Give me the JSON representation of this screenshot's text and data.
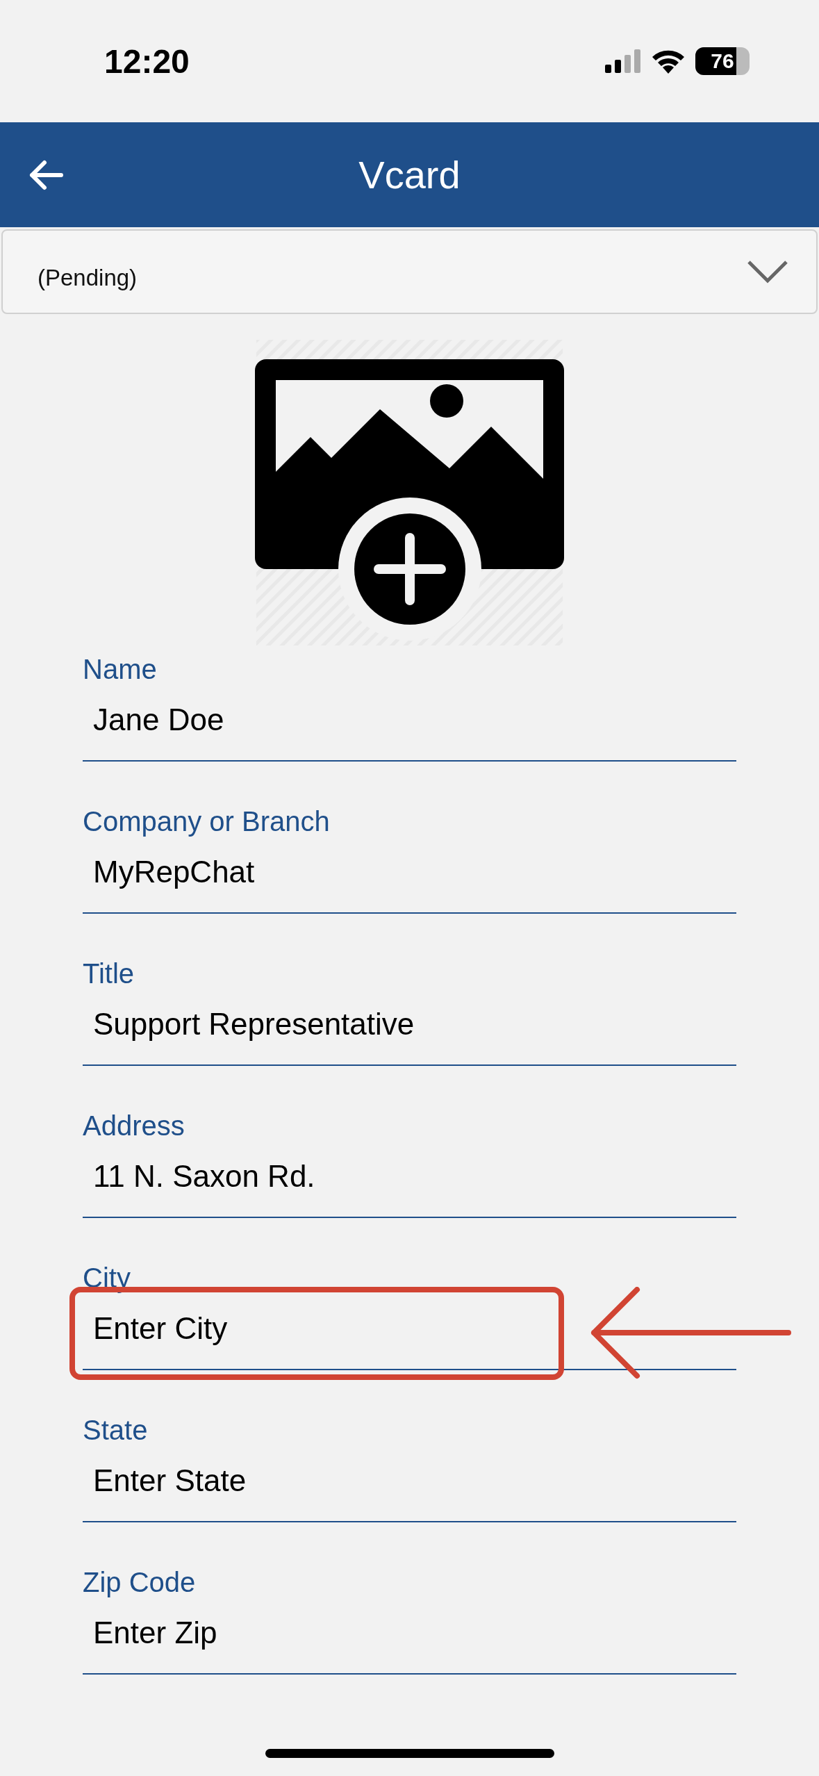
{
  "status_bar": {
    "time": "12:20",
    "battery": "76"
  },
  "header": {
    "title": "Vcard"
  },
  "dropdown": {
    "value": "(Pending)"
  },
  "photo": {
    "kind": "add-image"
  },
  "fields": [
    {
      "label": "Name",
      "value": "Jane Doe",
      "highlighted": false
    },
    {
      "label": "Company or Branch",
      "value": "MyRepChat",
      "highlighted": false
    },
    {
      "label": "Title",
      "value": "Support Representative",
      "highlighted": false
    },
    {
      "label": "Address",
      "value": "11 N. Saxon Rd.",
      "highlighted": false
    },
    {
      "label": "City",
      "value": "Enter City",
      "highlighted": true
    },
    {
      "label": "State",
      "value": "Enter State",
      "highlighted": false
    },
    {
      "label": "Zip Code",
      "value": "Enter Zip",
      "highlighted": false
    }
  ]
}
